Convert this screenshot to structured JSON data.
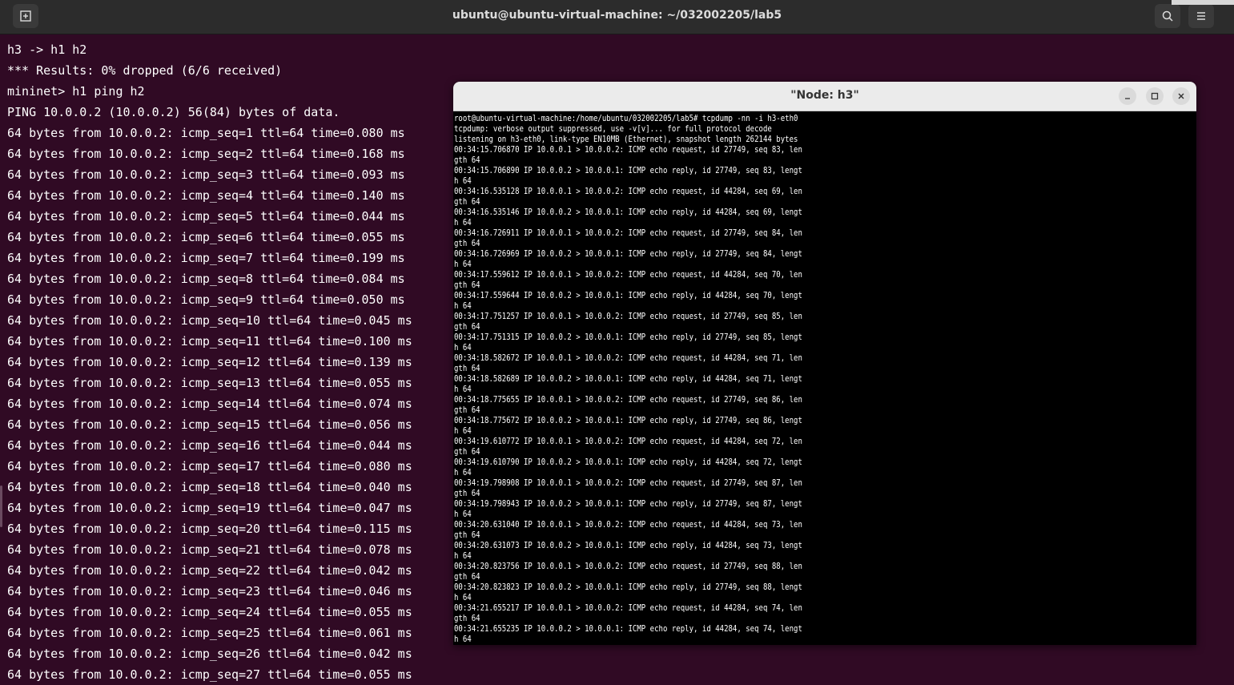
{
  "window": {
    "title": "ubuntu@ubuntu-virtual-machine: ~/032002205/lab5",
    "icons": {
      "new_tab": "new-tab-icon",
      "search": "search-icon",
      "menu": "hamburger-menu-icon"
    }
  },
  "main_terminal": {
    "lines": [
      "h3 -> h1 h2",
      "*** Results: 0% dropped (6/6 received)",
      "mininet> h1 ping h2",
      "PING 10.0.0.2 (10.0.0.2) 56(84) bytes of data.",
      "64 bytes from 10.0.0.2: icmp_seq=1 ttl=64 time=0.080 ms",
      "64 bytes from 10.0.0.2: icmp_seq=2 ttl=64 time=0.168 ms",
      "64 bytes from 10.0.0.2: icmp_seq=3 ttl=64 time=0.093 ms",
      "64 bytes from 10.0.0.2: icmp_seq=4 ttl=64 time=0.140 ms",
      "64 bytes from 10.0.0.2: icmp_seq=5 ttl=64 time=0.044 ms",
      "64 bytes from 10.0.0.2: icmp_seq=6 ttl=64 time=0.055 ms",
      "64 bytes from 10.0.0.2: icmp_seq=7 ttl=64 time=0.199 ms",
      "64 bytes from 10.0.0.2: icmp_seq=8 ttl=64 time=0.084 ms",
      "64 bytes from 10.0.0.2: icmp_seq=9 ttl=64 time=0.050 ms",
      "64 bytes from 10.0.0.2: icmp_seq=10 ttl=64 time=0.045 ms",
      "64 bytes from 10.0.0.2: icmp_seq=11 ttl=64 time=0.100 ms",
      "64 bytes from 10.0.0.2: icmp_seq=12 ttl=64 time=0.139 ms",
      "64 bytes from 10.0.0.2: icmp_seq=13 ttl=64 time=0.055 ms",
      "64 bytes from 10.0.0.2: icmp_seq=14 ttl=64 time=0.074 ms",
      "64 bytes from 10.0.0.2: icmp_seq=15 ttl=64 time=0.056 ms",
      "64 bytes from 10.0.0.2: icmp_seq=16 ttl=64 time=0.044 ms",
      "64 bytes from 10.0.0.2: icmp_seq=17 ttl=64 time=0.080 ms",
      "64 bytes from 10.0.0.2: icmp_seq=18 ttl=64 time=0.040 ms",
      "64 bytes from 10.0.0.2: icmp_seq=19 ttl=64 time=0.047 ms",
      "64 bytes from 10.0.0.2: icmp_seq=20 ttl=64 time=0.115 ms",
      "64 bytes from 10.0.0.2: icmp_seq=21 ttl=64 time=0.078 ms",
      "64 bytes from 10.0.0.2: icmp_seq=22 ttl=64 time=0.042 ms",
      "64 bytes from 10.0.0.2: icmp_seq=23 ttl=64 time=0.046 ms",
      "64 bytes from 10.0.0.2: icmp_seq=24 ttl=64 time=0.055 ms",
      "64 bytes from 10.0.0.2: icmp_seq=25 ttl=64 time=0.061 ms",
      "64 bytes from 10.0.0.2: icmp_seq=26 ttl=64 time=0.042 ms",
      "64 bytes from 10.0.0.2: icmp_seq=27 ttl=64 time=0.055 ms"
    ]
  },
  "node_window": {
    "title": "\"Node: h3\"",
    "icons": {
      "minimize": "minimize-icon",
      "maximize": "maximize-icon",
      "close": "close-icon"
    },
    "lines": [
      "root@ubuntu-virtual-machine:/home/ubuntu/032002205/lab5# tcpdump -nn -i h3-eth0",
      "tcpdump: verbose output suppressed, use -v[v]... for full protocol decode",
      "listening on h3-eth0, link-type EN10MB (Ethernet), snapshot length 262144 bytes",
      "00:34:15.706870 IP 10.0.0.1 > 10.0.0.2: ICMP echo request, id 27749, seq 83, len",
      "gth 64",
      "00:34:15.706890 IP 10.0.0.2 > 10.0.0.1: ICMP echo reply, id 27749, seq 83, lengt",
      "h 64",
      "00:34:16.535128 IP 10.0.0.1 > 10.0.0.2: ICMP echo request, id 44284, seq 69, len",
      "gth 64",
      "00:34:16.535146 IP 10.0.0.2 > 10.0.0.1: ICMP echo reply, id 44284, seq 69, lengt",
      "h 64",
      "00:34:16.726911 IP 10.0.0.1 > 10.0.0.2: ICMP echo request, id 27749, seq 84, len",
      "gth 64",
      "00:34:16.726969 IP 10.0.0.2 > 10.0.0.1: ICMP echo reply, id 27749, seq 84, lengt",
      "h 64",
      "00:34:17.559612 IP 10.0.0.1 > 10.0.0.2: ICMP echo request, id 44284, seq 70, len",
      "gth 64",
      "00:34:17.559644 IP 10.0.0.2 > 10.0.0.1: ICMP echo reply, id 44284, seq 70, lengt",
      "h 64",
      "00:34:17.751257 IP 10.0.0.1 > 10.0.0.2: ICMP echo request, id 27749, seq 85, len",
      "gth 64",
      "00:34:17.751315 IP 10.0.0.2 > 10.0.0.1: ICMP echo reply, id 27749, seq 85, lengt",
      "h 64",
      "00:34:18.582672 IP 10.0.0.1 > 10.0.0.2: ICMP echo request, id 44284, seq 71, len",
      "gth 64",
      "00:34:18.582689 IP 10.0.0.2 > 10.0.0.1: ICMP echo reply, id 44284, seq 71, lengt",
      "h 64",
      "00:34:18.775655 IP 10.0.0.1 > 10.0.0.2: ICMP echo request, id 27749, seq 86, len",
      "gth 64",
      "00:34:18.775672 IP 10.0.0.2 > 10.0.0.1: ICMP echo reply, id 27749, seq 86, lengt",
      "h 64",
      "00:34:19.610772 IP 10.0.0.1 > 10.0.0.2: ICMP echo request, id 44284, seq 72, len",
      "gth 64",
      "00:34:19.610790 IP 10.0.0.2 > 10.0.0.1: ICMP echo reply, id 44284, seq 72, lengt",
      "h 64",
      "00:34:19.798908 IP 10.0.0.1 > 10.0.0.2: ICMP echo request, id 27749, seq 87, len",
      "gth 64",
      "00:34:19.798943 IP 10.0.0.2 > 10.0.0.1: ICMP echo reply, id 27749, seq 87, lengt",
      "h 64",
      "00:34:20.631040 IP 10.0.0.1 > 10.0.0.2: ICMP echo request, id 44284, seq 73, len",
      "gth 64",
      "00:34:20.631073 IP 10.0.0.2 > 10.0.0.1: ICMP echo reply, id 44284, seq 73, lengt",
      "h 64",
      "00:34:20.823756 IP 10.0.0.1 > 10.0.0.2: ICMP echo request, id 27749, seq 88, len",
      "gth 64",
      "00:34:20.823823 IP 10.0.0.2 > 10.0.0.1: ICMP echo reply, id 27749, seq 88, lengt",
      "h 64",
      "00:34:21.655217 IP 10.0.0.1 > 10.0.0.2: ICMP echo request, id 44284, seq 74, len",
      "gth 64",
      "00:34:21.655235 IP 10.0.0.2 > 10.0.0.1: ICMP echo reply, id 44284, seq 74, lengt",
      "h 64"
    ]
  },
  "colors": {
    "terminal_bg": "#300a24",
    "titlebar_bg": "#2c2c2c",
    "node_bg": "#000000",
    "node_titlebar_bg": "#ebebeb",
    "text": "#ffffff"
  }
}
